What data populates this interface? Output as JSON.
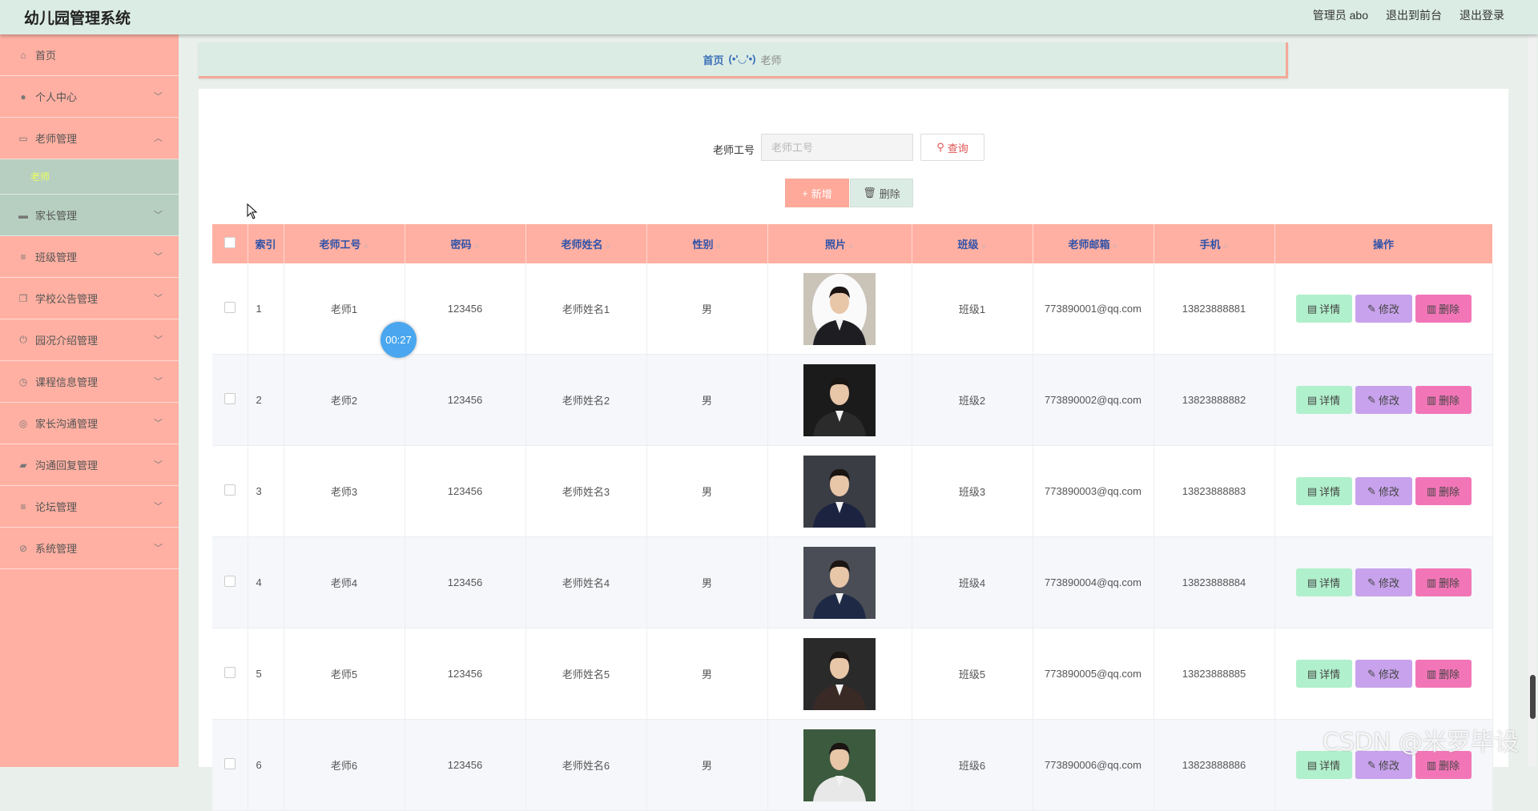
{
  "app": {
    "title": "幼儿园管理系统"
  },
  "header_links": [
    "管理员 abo",
    "退出到前台",
    "退出登录"
  ],
  "sidebar": {
    "items": [
      {
        "label": "首页",
        "icon": "home-icon",
        "chev": false
      },
      {
        "label": "个人中心",
        "icon": "user-icon",
        "chev": true
      },
      {
        "label": "老师管理",
        "icon": "chat-icon",
        "chev": true,
        "open": true,
        "sub": [
          "老师"
        ]
      },
      {
        "label": "家长管理",
        "icon": "monitor-icon",
        "chev": true,
        "active": true
      },
      {
        "label": "班级管理",
        "icon": "list-icon",
        "chev": true
      },
      {
        "label": "学校公告管理",
        "icon": "copy-icon",
        "chev": true
      },
      {
        "label": "园况介绍管理",
        "icon": "power-icon",
        "chev": true
      },
      {
        "label": "课程信息管理",
        "icon": "clock-icon",
        "chev": true
      },
      {
        "label": "家长沟通管理",
        "icon": "target-icon",
        "chev": true
      },
      {
        "label": "沟通回复管理",
        "icon": "briefcase-icon",
        "chev": true
      },
      {
        "label": "论坛管理",
        "icon": "list-icon",
        "chev": true
      },
      {
        "label": "系统管理",
        "icon": "settings-icon",
        "chev": true
      }
    ]
  },
  "breadcrumb": {
    "home": "首页",
    "face": "(•'◡'•)",
    "current": "老师"
  },
  "search": {
    "label": "老师工号",
    "placeholder": "老师工号",
    "value": "",
    "query_btn": "查询"
  },
  "actions": {
    "add": "新增",
    "delete": "删除"
  },
  "table": {
    "columns": [
      "索引",
      "老师工号",
      "密码",
      "老师姓名",
      "性别",
      "照片",
      "班级",
      "老师邮箱",
      "手机",
      "操作"
    ],
    "row_actions": {
      "detail": "详情",
      "edit": "修改",
      "delete": "删除"
    },
    "rows": [
      {
        "idx": "1",
        "no": "老师1",
        "pwd": "123456",
        "name": "老师姓名1",
        "sex": "男",
        "class": "班级1",
        "email": "773890001@qq.com",
        "phone": "13823888881"
      },
      {
        "idx": "2",
        "no": "老师2",
        "pwd": "123456",
        "name": "老师姓名2",
        "sex": "男",
        "class": "班级2",
        "email": "773890002@qq.com",
        "phone": "13823888882"
      },
      {
        "idx": "3",
        "no": "老师3",
        "pwd": "123456",
        "name": "老师姓名3",
        "sex": "男",
        "class": "班级3",
        "email": "773890003@qq.com",
        "phone": "13823888883"
      },
      {
        "idx": "4",
        "no": "老师4",
        "pwd": "123456",
        "name": "老师姓名4",
        "sex": "男",
        "class": "班级4",
        "email": "773890004@qq.com",
        "phone": "13823888884"
      },
      {
        "idx": "5",
        "no": "老师5",
        "pwd": "123456",
        "name": "老师姓名5",
        "sex": "男",
        "class": "班级5",
        "email": "773890005@qq.com",
        "phone": "13823888885"
      },
      {
        "idx": "6",
        "no": "老师6",
        "pwd": "123456",
        "name": "老师姓名6",
        "sex": "男",
        "class": "班级6",
        "email": "773890006@qq.com",
        "phone": "13823888886"
      }
    ]
  },
  "overlay": {
    "timer": "00:27",
    "watermark": "CSDN @米罗毕设"
  },
  "colors": {
    "sidebar": "#ffb0a2",
    "header": "#dbece4",
    "accent": "#f276b7",
    "edit": "#c8a2ec",
    "detail": "#b1f0cc"
  }
}
